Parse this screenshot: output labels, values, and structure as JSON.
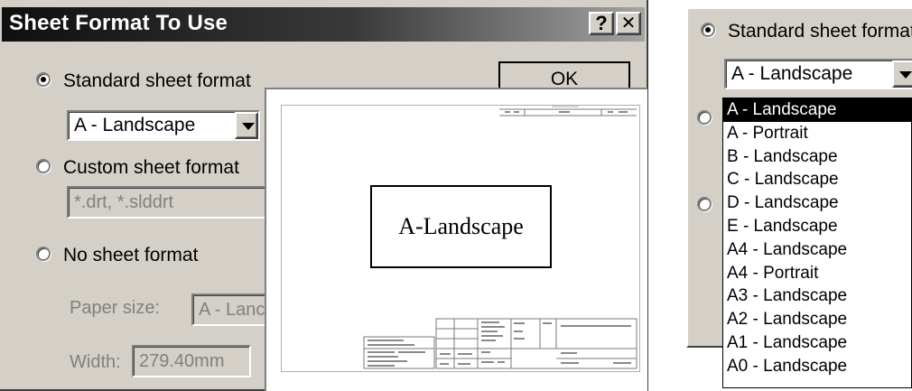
{
  "dialog": {
    "title": "Sheet Format To Use",
    "help_glyph": "?",
    "close_glyph": "✕",
    "ok_label": "OK",
    "standard_label": "Standard sheet format",
    "standard_value": "A - Landscape",
    "custom_label": "Custom sheet format",
    "custom_value": "*.drt, *.slddrt",
    "none_label": "No sheet format",
    "paper_size_label": "Paper size:",
    "paper_size_value": "A - Lanc",
    "width_label": "Width:",
    "width_value": "279.40mm"
  },
  "preview": {
    "callout_text": "A-Landscape"
  },
  "right_panel": {
    "standard_label": "Standard sheet format",
    "combo_value": "A - Landscape",
    "options": [
      "A - Landscape",
      "A - Portrait",
      "B - Landscape",
      "C - Landscape",
      "D - Landscape",
      "E - Landscape",
      "A4 - Landscape",
      "A4 - Portrait",
      "A3 - Landscape",
      "A2 - Landscape",
      "A1 - Landscape",
      "A0 - Landscape"
    ],
    "selected_index": 0
  },
  "colors": {
    "face": "#d4d0c8",
    "title_dark": "#0f0f0f",
    "title_light": "#a3a3a3",
    "selection": "#000000"
  },
  "icons": {
    "help": "help-icon",
    "close": "close-icon",
    "dropdown": "chevron-down-icon",
    "radio": "radio-icon"
  }
}
